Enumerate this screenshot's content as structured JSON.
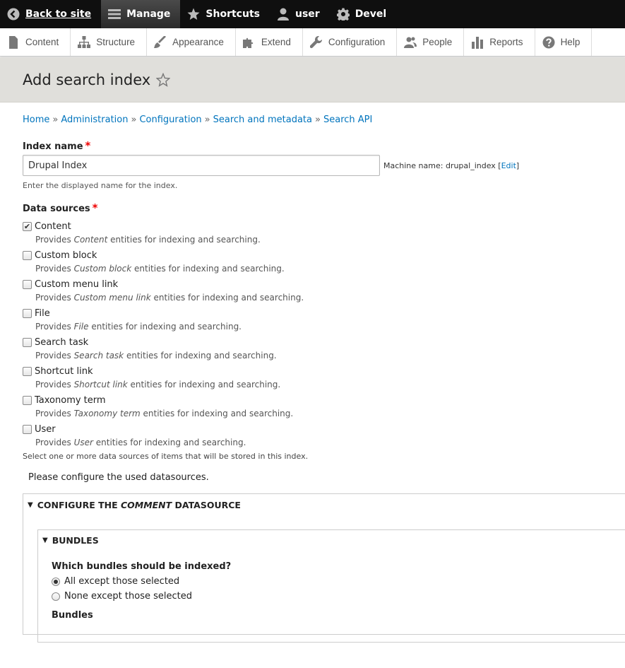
{
  "toolbar": {
    "items": [
      {
        "label": "Back to site",
        "icon": "back-icon"
      },
      {
        "label": "Manage",
        "icon": "hamburger-icon"
      },
      {
        "label": "Shortcuts",
        "icon": "star-icon"
      },
      {
        "label": "user",
        "icon": "user-icon"
      },
      {
        "label": "Devel",
        "icon": "gear-icon"
      }
    ]
  },
  "tray": {
    "items": [
      {
        "label": "Content",
        "icon": "file-icon"
      },
      {
        "label": "Structure",
        "icon": "sitemap-icon"
      },
      {
        "label": "Appearance",
        "icon": "paintbrush-icon"
      },
      {
        "label": "Extend",
        "icon": "puzzle-icon"
      },
      {
        "label": "Configuration",
        "icon": "wrench-icon"
      },
      {
        "label": "People",
        "icon": "people-icon"
      },
      {
        "label": "Reports",
        "icon": "bar-chart-icon"
      },
      {
        "label": "Help",
        "icon": "help-icon"
      }
    ]
  },
  "page": {
    "title": "Add search index"
  },
  "breadcrumb": [
    "Home",
    "Administration",
    "Configuration",
    "Search and metadata",
    "Search API"
  ],
  "index_name": {
    "label": "Index name",
    "value": "Drupal Index",
    "machine_prefix": "Machine name: drupal_index",
    "edit_link": "Edit",
    "description": "Enter the displayed name for the index."
  },
  "data_sources": {
    "label": "Data sources",
    "items": [
      {
        "label": "Content",
        "entity": "Content",
        "checked": true
      },
      {
        "label": "Custom block",
        "entity": "Custom block",
        "checked": false
      },
      {
        "label": "Custom menu link",
        "entity": "Custom menu link",
        "checked": false
      },
      {
        "label": "File",
        "entity": "File",
        "checked": false
      },
      {
        "label": "Search task",
        "entity": "Search task",
        "checked": false
      },
      {
        "label": "Shortcut link",
        "entity": "Shortcut link",
        "checked": false
      },
      {
        "label": "Taxonomy term",
        "entity": "Taxonomy term",
        "checked": false
      },
      {
        "label": "User",
        "entity": "User",
        "checked": false
      }
    ],
    "desc_prefix": "Provides",
    "desc_suffix": "entities for indexing and searching.",
    "help": "Select one or more data sources of items that will be stored in this index."
  },
  "configure_note": "Please configure the used datasources.",
  "datasource_config": {
    "summary_prefix": "CONFIGURE THE",
    "summary_name": "COMMENT",
    "summary_suffix": "DATASOURCE",
    "bundles": {
      "summary": "BUNDLES",
      "question": "Which bundles should be indexed?",
      "options": [
        {
          "label": "All except those selected",
          "selected": true
        },
        {
          "label": "None except those selected",
          "selected": false
        }
      ],
      "bundles_label": "Bundles"
    }
  },
  "colors": {
    "link": "#0074bd",
    "required": "#ee0000",
    "toolbar_bg": "#0f0f0f",
    "header_bg": "#e0dfdb"
  }
}
